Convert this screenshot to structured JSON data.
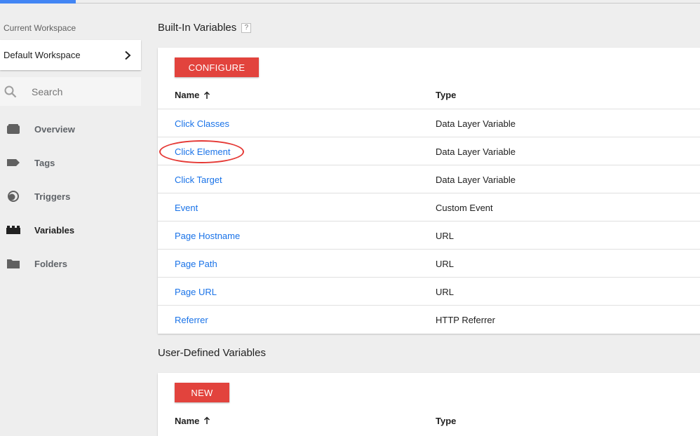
{
  "colors": {
    "accent_blue": "#4285f4",
    "button_red": "#e2433d",
    "link_blue": "#1a73e8",
    "highlight_red": "#e53935"
  },
  "sidebar": {
    "workspace_label": "Current Workspace",
    "workspace_name": "Default Workspace",
    "search_placeholder": "Search",
    "items": [
      {
        "label": "Overview",
        "icon": "overview-icon"
      },
      {
        "label": "Tags",
        "icon": "tag-icon"
      },
      {
        "label": "Triggers",
        "icon": "trigger-icon"
      },
      {
        "label": "Variables",
        "icon": "variables-icon",
        "active": true
      },
      {
        "label": "Folders",
        "icon": "folder-icon"
      }
    ]
  },
  "builtin": {
    "title": "Built-In Variables",
    "help": "?",
    "button": "CONFIGURE",
    "col_name": "Name",
    "col_type": "Type",
    "rows": [
      {
        "name": "Click Classes",
        "type": "Data Layer Variable"
      },
      {
        "name": "Click Element",
        "type": "Data Layer Variable",
        "highlighted": true
      },
      {
        "name": "Click Target",
        "type": "Data Layer Variable"
      },
      {
        "name": "Event",
        "type": "Custom Event"
      },
      {
        "name": "Page Hostname",
        "type": "URL"
      },
      {
        "name": "Page Path",
        "type": "URL"
      },
      {
        "name": "Page URL",
        "type": "URL"
      },
      {
        "name": "Referrer",
        "type": "HTTP Referrer"
      }
    ]
  },
  "user_defined": {
    "title": "User-Defined Variables",
    "button": "NEW",
    "col_name": "Name",
    "col_type": "Type"
  }
}
